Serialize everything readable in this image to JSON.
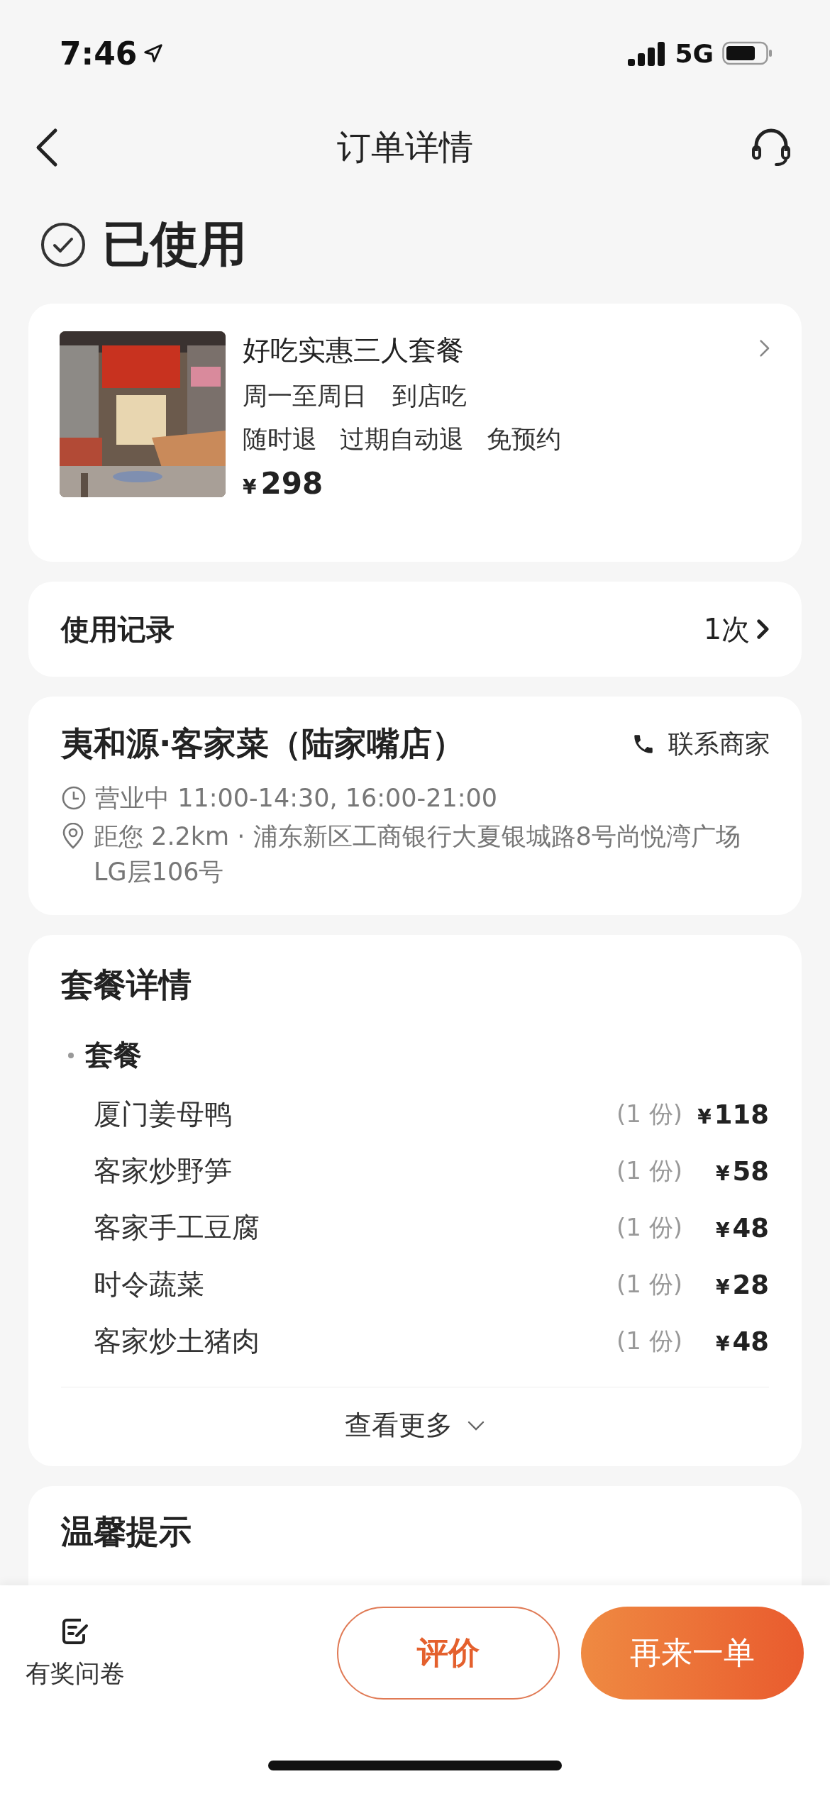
{
  "status_bar": {
    "time": "7:46",
    "network": "5G"
  },
  "nav": {
    "title": "订单详情"
  },
  "order_status": {
    "label": "已使用"
  },
  "deal": {
    "image": {
      "kind": "picture"
    },
    "title": "好吃实惠三人套餐",
    "schedule": [
      "周一至周日",
      "到店吃"
    ],
    "tags": [
      "随时退",
      "过期自动退",
      "免预约"
    ],
    "currency": "¥",
    "price": "298"
  },
  "usage_record": {
    "label": "使用记录",
    "count": "1次"
  },
  "store": {
    "name": "夷和源·客家菜（陆家嘴店）",
    "contact": "联系商家",
    "hours": "营业中 11:00-14:30, 16:00-21:00",
    "location": "距您 2.2km · 浦东新区工商银行大夏银城路8号尚悦湾广场LG层106号"
  },
  "package": {
    "title": "套餐详情",
    "group": "套餐",
    "items": [
      {
        "name": "厦门姜母鸭",
        "quantity": "(1 份)",
        "currency": "¥",
        "price": "118"
      },
      {
        "name": "客家炒野笋",
        "quantity": "(1 份)",
        "currency": "¥",
        "price": "58"
      },
      {
        "name": "客家手工豆腐",
        "quantity": "(1 份)",
        "currency": "¥",
        "price": "48"
      },
      {
        "name": "时令蔬菜",
        "quantity": "(1 份)",
        "currency": "¥",
        "price": "28"
      },
      {
        "name": "客家炒土猪肉",
        "quantity": "(1 份)",
        "currency": "¥",
        "price": "48"
      }
    ],
    "more": "查看更多"
  },
  "tips": {
    "title": "温馨提示"
  },
  "bottom_bar": {
    "survey": "有奖问卷",
    "buttons": [
      {
        "label": "评价",
        "kind": "outline"
      },
      {
        "label": "再来一单",
        "kind": "primary"
      }
    ]
  }
}
